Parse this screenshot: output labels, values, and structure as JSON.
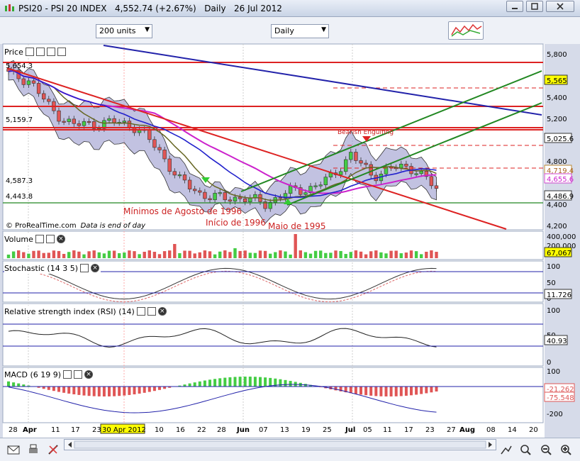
{
  "window": {
    "title": "PSI20 - PSI 20 INDEX",
    "price": "4,552.74 (+2.67%)",
    "period": "Daily",
    "date": "26 Jul 2012"
  },
  "toolbar": {
    "units_select": "200 units",
    "period_select": "Daily"
  },
  "colors": {
    "up": "#44cc44",
    "down": "#e05555",
    "bollinger": "#9090c8",
    "red_line": "#dd2222",
    "green_line": "#228822",
    "blue_line": "#2222aa",
    "magenta": "#cc22cc"
  },
  "panels": {
    "price": {
      "label": "Price",
      "watermark": "© ProRealTime.com",
      "note": "Data is end of day",
      "left_levels": [
        "5,654.3",
        "5,159.7",
        "4,587.3",
        "4,443.8"
      ],
      "right_ticks": [
        "5,800",
        "5,400",
        "5,200",
        "4,800",
        "4,400",
        "4,200"
      ],
      "badges": [
        "5,565",
        "5,025.6",
        "4,719.4",
        "4,655.6",
        "4,486.9"
      ],
      "annotations": [
        "Bearish Engulfing",
        "Mínimos de Agosto de 1996",
        "Início de 1996",
        "Maio de 1995"
      ]
    },
    "volume": {
      "label": "Volume",
      "right_ticks": [
        "400,000",
        "200,000"
      ],
      "badge": "67,067"
    },
    "stochastic": {
      "label": "Stochastic (14 3 5)",
      "right_ticks": [
        "100",
        "50",
        "0"
      ],
      "badge": "11.726"
    },
    "rsi": {
      "label": "Relative strength index (RSI) (14)",
      "right_ticks": [
        "100",
        "50",
        "0"
      ],
      "badge": "40.93"
    },
    "macd": {
      "label": "MACD (6 19 9)",
      "right_ticks": [
        "100",
        "0",
        "-100",
        "-200"
      ],
      "badges": [
        "-21.262",
        "-75.548"
      ]
    }
  },
  "xaxis": {
    "labels": [
      "28",
      "Apr",
      "11",
      "17",
      "23",
      "30 Apr 2012",
      "10",
      "16",
      "22",
      "28",
      "Jun",
      "07",
      "13",
      "19",
      "25",
      "Jul",
      "05",
      "11",
      "17",
      "23",
      "27",
      "Aug",
      "08",
      "14",
      "20"
    ]
  },
  "chart_data": {
    "type": "line",
    "title": "PSI20 - PSI 20 INDEX",
    "series": [
      {
        "name": "PSI20",
        "x": [
          "Mar 28",
          "Apr 03",
          "Apr 11",
          "Apr 17",
          "Apr 23",
          "Apr 30",
          "May 10",
          "May 16",
          "May 22",
          "May 28",
          "Jun 01",
          "Jun 07",
          "Jun 13",
          "Jun 19",
          "Jun 25",
          "Jul 02",
          "Jul 05",
          "Jul 11",
          "Jul 17",
          "Jul 23",
          "Jul 26"
        ],
        "values": [
          5620,
          5560,
          5290,
          5150,
          5160,
          5180,
          5130,
          4920,
          4640,
          4510,
          4470,
          4480,
          4420,
          4530,
          4560,
          4650,
          4880,
          4680,
          4760,
          4750,
          4553
        ]
      }
    ],
    "ylim": [
      4100,
      5900
    ]
  }
}
